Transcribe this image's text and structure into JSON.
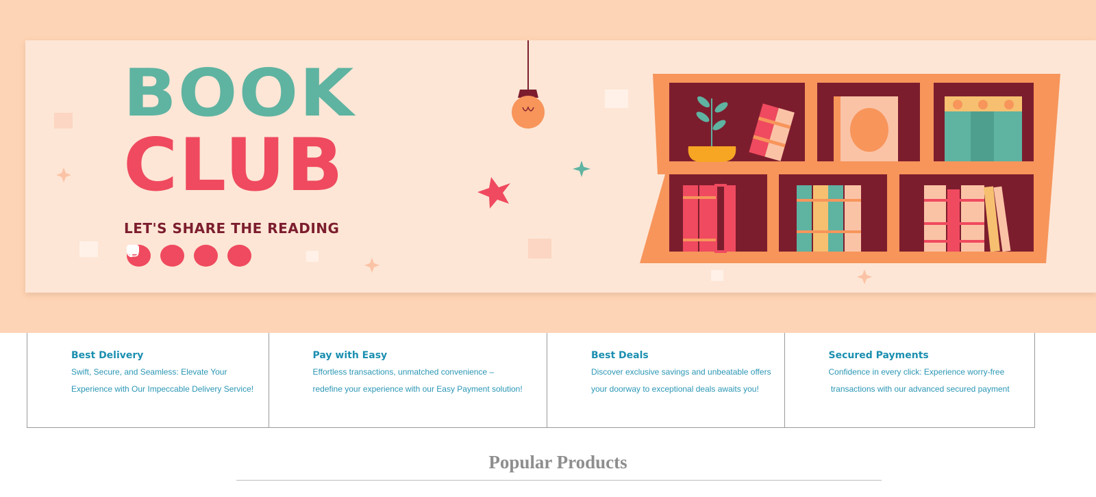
{
  "banner": {
    "logo_line1": "BOOK",
    "logo_line2": "CLUB",
    "tagline": "LET'S SHARE THE READING",
    "social_icons": [
      "youtube-icon",
      "facebook-icon",
      "instagram-icon",
      "twitter-icon"
    ],
    "colors": {
      "background": "#fde6d6",
      "outer": "#fdd4b5",
      "teal": "#5fb3a1",
      "coral": "#ef4a5f",
      "maroon": "#7c1d2e",
      "orange": "#f7955b"
    }
  },
  "features": [
    {
      "title": "Best Delivery",
      "line1": "Swift, Secure, and Seamless: Elevate Your",
      "line2": "Experience with Our Impeccable Delivery Service!"
    },
    {
      "title": "Pay with Easy",
      "line1": "Effortless transactions, unmatched convenience –",
      "line2": "redefine your experience with our Easy Payment solution!"
    },
    {
      "title": "Best Deals",
      "line1": "Discover exclusive savings and unbeatable offers",
      "line2": "your doorway to exceptional deals awaits you!"
    },
    {
      "title": "Secured Payments",
      "line1": "Confidence in every click: Experience worry-free",
      "line2": " transactions with our advanced secured payment"
    }
  ],
  "section": {
    "title": "Popular Products"
  }
}
